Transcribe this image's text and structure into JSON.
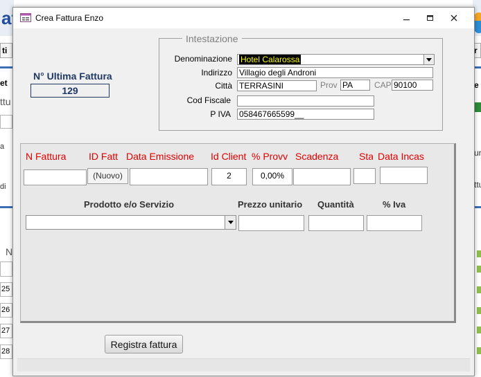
{
  "window": {
    "title": "Crea Fattura Enzo"
  },
  "background": {
    "title_fragment": "at",
    "tab_left": "ti",
    "tab_right": "r ti",
    "left_texts": [
      "et",
      "ttu",
      "a",
      "di",
      "N"
    ],
    "right_texts": [
      "ur",
      "ttu"
    ],
    "rows": [
      "25",
      "26",
      "27",
      "28"
    ]
  },
  "last_invoice": {
    "label": "N° Ultima Fattura",
    "value": "129"
  },
  "header": {
    "legend": "Intestazione",
    "denominazione_label": "Denominazione",
    "denominazione_value": "Hotel Calarossa",
    "indirizzo_label": "Indirizzo",
    "indirizzo_value": "Villagio degli Androni",
    "citta_label": "Città",
    "citta_value": "TERRASINI",
    "prov_label": "Prov",
    "prov_value": "PA",
    "cap_label": "CAP",
    "cap_value": "90100",
    "codfiscale_label": "Cod Fiscale",
    "codfiscale_value": "",
    "piva_label": "P IVA",
    "piva_value": "058467665599__"
  },
  "invoice_fields": {
    "n_fattura_label": "N Fattura",
    "id_fatt_label": "ID Fatt",
    "id_fatt_value": "(Nuovo)",
    "data_emissione_label": "Data Emissione",
    "id_cliente_label": "Id Client",
    "id_cliente_value": "2",
    "provv_label": "% Provv",
    "provv_value": "0,00%",
    "scadenza_label": "Scadenza",
    "stato_label": "Sta",
    "data_incasso_label": "Data Incas"
  },
  "line_item": {
    "prodotto_label": "Prodotto e/o Servizio",
    "prezzo_label": "Prezzo unitario",
    "quantita_label": "Quantità",
    "iva_label": "% Iva"
  },
  "actions": {
    "register_label": "Registra fattura"
  },
  "colors": {
    "accent_blue": "#1f3864",
    "label_red": "#e00000",
    "highlight_bg": "#000000",
    "highlight_fg": "#ffff00"
  },
  "icons": {
    "app": "form-window-icon",
    "minimize": "minimize-icon",
    "maximize": "maximize-icon",
    "close": "close-icon",
    "dropdown": "chevron-down-icon"
  }
}
